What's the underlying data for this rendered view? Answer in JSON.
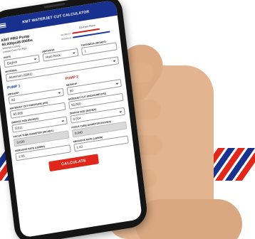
{
  "colors": {
    "header": "#18308e",
    "accent_red": "#e1261c",
    "pump1": "#1a3aa8",
    "pump2": "#d0211c"
  },
  "header": {
    "title": "KMT WATERJET CUT CALCULATOR",
    "menu_icon": "hamburger-menu-icon"
  },
  "pump": {
    "name": "KMT PRO Pump",
    "spec": "60,000psi/6.000lbs",
    "sub1": "Waterjet Cutting",
    "sub2": "Lowest Cost Per Part"
  },
  "cost_chart": {
    "title": "Cost per Piece",
    "bars": [
      {
        "label": "60,000 psi",
        "level": 0.7,
        "color": "#d0211c"
      },
      {
        "label": "90,000 psi",
        "level": 0.95,
        "color": "#1a3aa8"
      }
    ]
  },
  "fields": {
    "units": {
      "label": "UNITS",
      "value": "English"
    },
    "abrasive": {
      "label": "ABRASIVE",
      "value": "Hard Rock"
    },
    "thickness": {
      "label": "THICKNESS (INCHES)",
      "value": "1"
    },
    "material": {
      "label": "MATERIAL",
      "value": "Aluminum (6061)"
    }
  },
  "pump1": {
    "heading": "PUMP 1",
    "mesh_label": "MESH/HP",
    "mesh_value": "60",
    "pressure_label": "WATERJET CUT PRESSURE (PSI)",
    "pressure_value": "65,000",
    "orifice_label": "ORIFICE SIZE (INCHES)",
    "orifice_value": "0.011",
    "focus_label": "FOCUS TUBE DIAMETER (INCHES)",
    "focus_value": "0.030",
    "abrasive_rate_label": "ABRASIVE RATE (LB/MIN)",
    "abrasive_rate_value": "1.05"
  },
  "pump2": {
    "heading": "PUMP 2",
    "mesh_label": "MESH/HP",
    "mesh_value": "50",
    "pressure_label": "WATERJET CUT PRESSURE (PSI)",
    "pressure_value": "55,000",
    "orifice_label": "ORIFICE SIZE (INCHES)",
    "orifice_value": "0.014",
    "focus_label": "FOCUS TUBE DIAMETER (INCHES)",
    "focus_value": "0.040",
    "abrasive_rate_label": "ABRASIVE RATE (LB/MIN)",
    "abrasive_rate_value": "1.43"
  },
  "calculate_label": "CALCULATE"
}
